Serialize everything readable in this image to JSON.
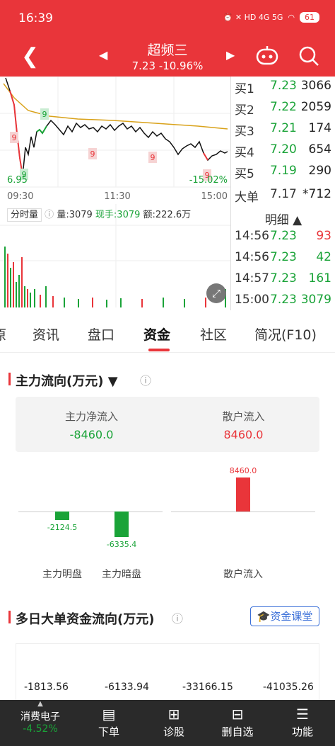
{
  "status": {
    "time": "16:39",
    "indicators": "⏰ ✕ HD 4G 5G",
    "wifi": "wifi-icon",
    "battery": "61"
  },
  "nav": {
    "title": "超频三",
    "price_change": "7.23 -10.96%",
    "back_icon": "back-arrow-icon",
    "prev_icon": "prev-stock-icon",
    "next_icon": "next-stock-icon"
  },
  "intraday": {
    "low_label": "6.95",
    "change_label": "-15.02%",
    "time_labels": [
      "09:30",
      "11:30",
      "15:00"
    ],
    "markers": [
      "9",
      "9",
      "9",
      "9",
      "9",
      "9"
    ],
    "volume_bar": {
      "mode": "分时量",
      "vol": "量:3079",
      "last": "现手:3079",
      "amount": "额:222.6万"
    }
  },
  "quotes": [
    {
      "label": "买1",
      "price": "7.23",
      "vol": "3066"
    },
    {
      "label": "买2",
      "price": "7.22",
      "vol": "2059"
    },
    {
      "label": "买3",
      "price": "7.21",
      "vol": "174"
    },
    {
      "label": "买4",
      "price": "7.20",
      "vol": "654"
    },
    {
      "label": "买5",
      "price": "7.19",
      "vol": "290"
    }
  ],
  "big_order": {
    "label": "大单",
    "price": "7.17",
    "vol": "*712"
  },
  "detail": {
    "header": "明细 ▲",
    "rows": [
      {
        "time": "14:56",
        "price": "7.23",
        "vol": "93"
      },
      {
        "time": "14:56",
        "price": "7.23",
        "vol": "42"
      },
      {
        "time": "14:57",
        "price": "7.23",
        "vol": "161"
      },
      {
        "time": "15:00",
        "price": "7.23",
        "vol": "3079"
      }
    ]
  },
  "tabs": [
    {
      "label": "原"
    },
    {
      "label": "资讯"
    },
    {
      "label": "盘口"
    },
    {
      "label": "资金"
    },
    {
      "label": "社区"
    },
    {
      "label": "简况(F10)"
    }
  ],
  "flow": {
    "title": "主力流向(万元) ▼",
    "net_label": "主力净流入",
    "net_value": "-8460.0",
    "retail_label": "散户流入",
    "retail_value": "8460.0",
    "bars": [
      {
        "label": "主力明盘",
        "value": "-2124.5"
      },
      {
        "label": "主力暗盘",
        "value": "-6335.4"
      },
      {
        "label": "散户流入",
        "value": "8460.0"
      }
    ]
  },
  "multi": {
    "title": "多日大单资金流向(万元)",
    "button": "资金课堂",
    "values": [
      "-1813.56",
      "-6133.94",
      "-33166.15",
      "-41035.26"
    ]
  },
  "bottom": {
    "sector": "消费电子",
    "sector_change": "-4.52%",
    "items": [
      "下单",
      "诊股",
      "删自选",
      "功能"
    ]
  },
  "chart_data": {
    "type": "bar",
    "categories": [
      "主力明盘",
      "主力暗盘",
      "散户流入"
    ],
    "values": [
      -2124.5,
      -6335.4,
      8460.0
    ]
  }
}
